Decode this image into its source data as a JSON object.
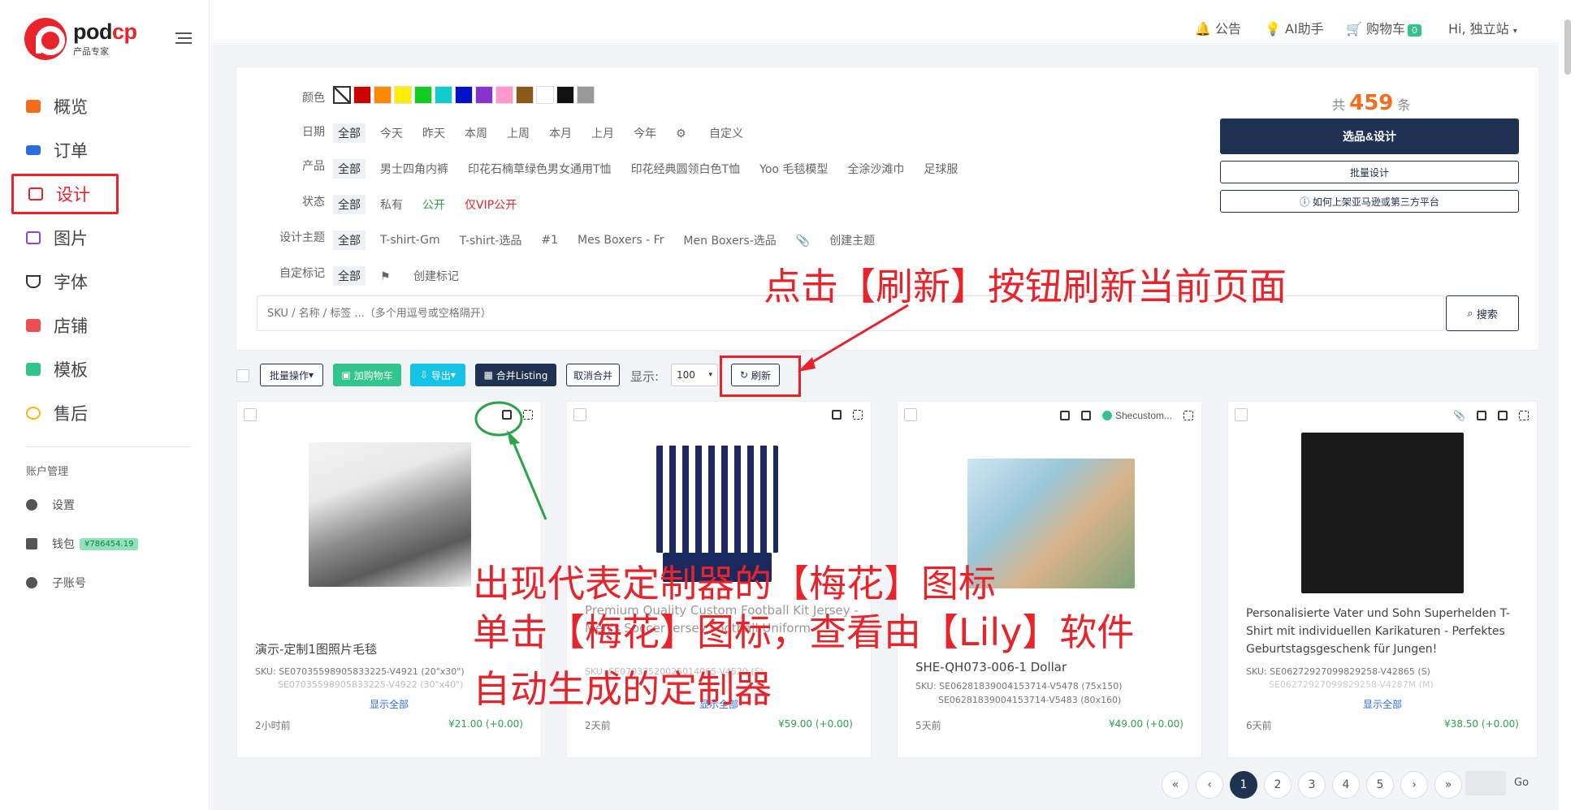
{
  "brand": {
    "name_a": "pod",
    "name_b": "cp",
    "sub": "产品专家"
  },
  "nav": [
    {
      "label": "概览",
      "color": "#f36d21"
    },
    {
      "label": "订单",
      "color": "#2d6cdf"
    },
    {
      "label": "设计",
      "color": "#e8232a"
    },
    {
      "label": "图片",
      "color": "#8f44d8"
    },
    {
      "label": "字体",
      "color": "#333333"
    },
    {
      "label": "店铺",
      "color": "#e8232a"
    },
    {
      "label": "模板",
      "color": "#31c48d"
    },
    {
      "label": "售后",
      "color": "#f2b90c"
    }
  ],
  "account": {
    "title": "账户管理",
    "settings": "设置",
    "wallet": "钱包",
    "wallet_balance": "¥786454.19",
    "sub_account": "子账号"
  },
  "topbar": {
    "notice": "公告",
    "ai": "AI助手",
    "cart": "购物车",
    "cart_count": "0",
    "user": "Hi, 独立站"
  },
  "filters": {
    "color_label": "颜色",
    "colors": [
      "#cc0000",
      "#ff8800",
      "#ffee00",
      "#11cc22",
      "#11cccc",
      "#0011cc",
      "#8833cc",
      "#ff99cc",
      "#8b5a1b",
      "#ffffff",
      "#111111",
      "#999999"
    ],
    "date_label": "日期",
    "dates": [
      "全部",
      "今天",
      "昨天",
      "本周",
      "上周",
      "本月",
      "上月",
      "今年",
      "自定义"
    ],
    "product_label": "产品",
    "products": [
      "全部",
      "男士四角内裤",
      "印花石楠草绿色男女通用T恤",
      "印花经典圆领白色T恤",
      "Yoo 毛毯模型",
      "全涂沙滩巾",
      "足球服"
    ],
    "status_label": "状态",
    "statuses": [
      "全部",
      "私有",
      "公开",
      "仅VIP公开"
    ],
    "theme_label": "设计主题",
    "themes": [
      "全部",
      "T-shirt-Gm",
      "T-shirt-选品",
      "#1",
      "Mes Boxers - Fr",
      "Men Boxers-选品",
      "创建主题"
    ],
    "tag_label": "自定标记",
    "tags": [
      "全部",
      "创建标记"
    ]
  },
  "summary": {
    "prefix": "共",
    "count": "459",
    "suffix": "条",
    "primary_btn": "选品&设计",
    "batch_btn": "批量设计",
    "help_btn": "如何上架亚马逊或第三方平台"
  },
  "search": {
    "placeholder": "SKU / 名称 / 标签 ...（多个用逗号或空格隔开）",
    "button": "搜索"
  },
  "toolbar": {
    "batch_ops": "批量操作",
    "add_cart": "加购物车",
    "export": "导出",
    "merge": "合并Listing",
    "unmerge": "取消合并",
    "show_label": "显示:",
    "page_size": "100",
    "refresh": "刷新"
  },
  "cards": [
    {
      "title": "演示-定制1图照片毛毯",
      "sku1": "SKU: SE07035598905833225-V4921",
      "size1": "(20\"x30\")",
      "sku2": "SE07035598905833225-V4922",
      "size2": "(30\"x40\")",
      "more": "显示全部",
      "time": "2小时前",
      "price": "¥21.00 (+0.00)"
    },
    {
      "title": "Premium Quality Custom Football Kit Jersey - Men's Soccer Jersey Football Uniform",
      "sku1": "SKU: SE07037520025014065-V4520",
      "size1": "(S)",
      "more": "显示全部",
      "time": "2天前",
      "price": "¥59.00 (+0.00)"
    },
    {
      "title": "SHE-QH073-006-1 Dollar",
      "store": "Shecustom...",
      "sku1": "SKU: SE06281839004153714-V5478",
      "size1": "(75x150)",
      "sku2": "SE06281839004153714-V5483",
      "size2": "(80x160)",
      "more": "显示全部",
      "time": "5天前",
      "price": "¥49.00 (+0.00)"
    },
    {
      "title": "Personalisierte Vater und Sohn Superhelden T-Shirt mit individuellen Karikaturen - Perfektes Geburtstagsgeschenk für Jungen!",
      "sku1": "SKU: SE06272927099829258-V42865",
      "size1": "(S)",
      "sku2": "SE06272927099829258-V4287M",
      "size2": "(M)",
      "more": "显示全部",
      "time": "6天前",
      "price": "¥38.50 (+0.00)"
    }
  ],
  "pagination": {
    "first": "«",
    "prev": "‹",
    "pages": [
      "1",
      "2",
      "3",
      "4",
      "5"
    ],
    "next": "›",
    "last": "»",
    "go": "Go"
  },
  "annotations": {
    "refresh_note": "点击【刷新】按钮刷新当前页面",
    "line1": "出现代表定制器的【梅花】图标",
    "line2": "单击【梅花】图标，查看由【Lily】软件",
    "line3": "自动生成的定制器"
  }
}
